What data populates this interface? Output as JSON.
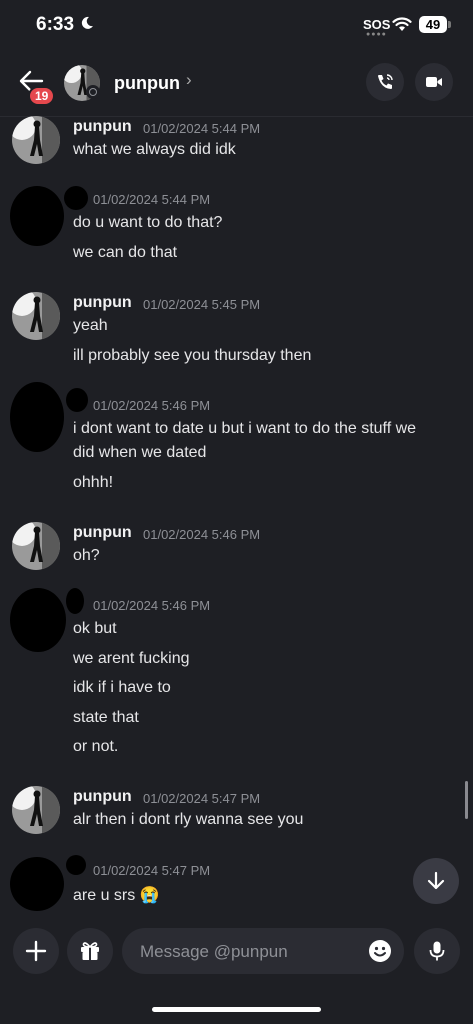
{
  "status_bar": {
    "time": "6:33",
    "sos": "SOS",
    "battery": "49"
  },
  "header": {
    "unread_badge": "19",
    "contact_name": "punpun",
    "chevron": "›"
  },
  "messages": [
    {
      "author": "punpun",
      "timestamp": "01/02/2024 5:44 PM",
      "lines": [
        "what we always did idk"
      ]
    },
    {
      "author": "",
      "timestamp": "01/02/2024 5:44 PM",
      "lines": [
        "do u want to do that?",
        "we can do that"
      ]
    },
    {
      "author": "punpun",
      "timestamp": "01/02/2024 5:45 PM",
      "lines": [
        "yeah",
        "ill probably see you thursday then"
      ]
    },
    {
      "author": "",
      "timestamp": "01/02/2024 5:46 PM",
      "lines": [
        "i dont want to date u but i want to do the stuff we",
        "did when we dated",
        "ohhh!"
      ]
    },
    {
      "author": "punpun",
      "timestamp": "01/02/2024 5:46 PM",
      "lines": [
        "oh?"
      ]
    },
    {
      "author": "",
      "timestamp": "01/02/2024 5:46 PM",
      "lines": [
        "ok but",
        "we arent fucking",
        "idk if i have to",
        "state that",
        "or not."
      ]
    },
    {
      "author": "punpun",
      "timestamp": "01/02/2024 5:47 PM",
      "lines": [
        "alr then i dont rly wanna see you"
      ]
    },
    {
      "author": "",
      "timestamp": "01/02/2024 5:47 PM",
      "lines": [
        "are u srs 😭"
      ]
    }
  ],
  "composer": {
    "placeholder": "Message @punpun"
  },
  "icons": {
    "back": "arrow-left-icon",
    "call": "phone-icon",
    "video": "video-camera-icon",
    "add": "plus-icon",
    "gift": "gift-icon",
    "emoji": "smiley-icon",
    "mic": "microphone-icon",
    "jump": "arrow-down-icon"
  },
  "colors": {
    "background": "#1e1f24",
    "badge": "#e5484d",
    "muted": "#8e9096"
  }
}
